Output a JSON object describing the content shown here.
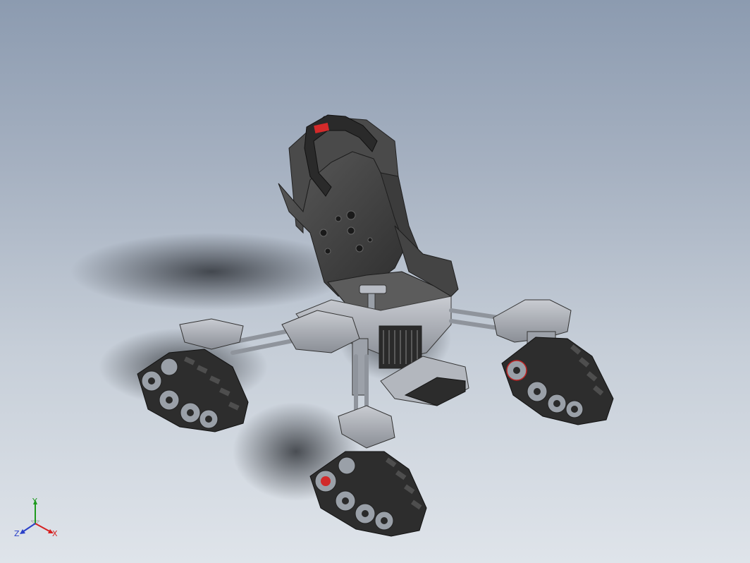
{
  "viewport": {
    "background_top": "#8c9bb0",
    "background_bottom": "#dfe4ea",
    "model": "tracked-wheelchair-assembly"
  },
  "triad": {
    "x_label": "X",
    "y_label": "Y",
    "z_label": "Z",
    "x_color": "#d62020",
    "y_color": "#1e9a1e",
    "z_color": "#2a40c8"
  }
}
